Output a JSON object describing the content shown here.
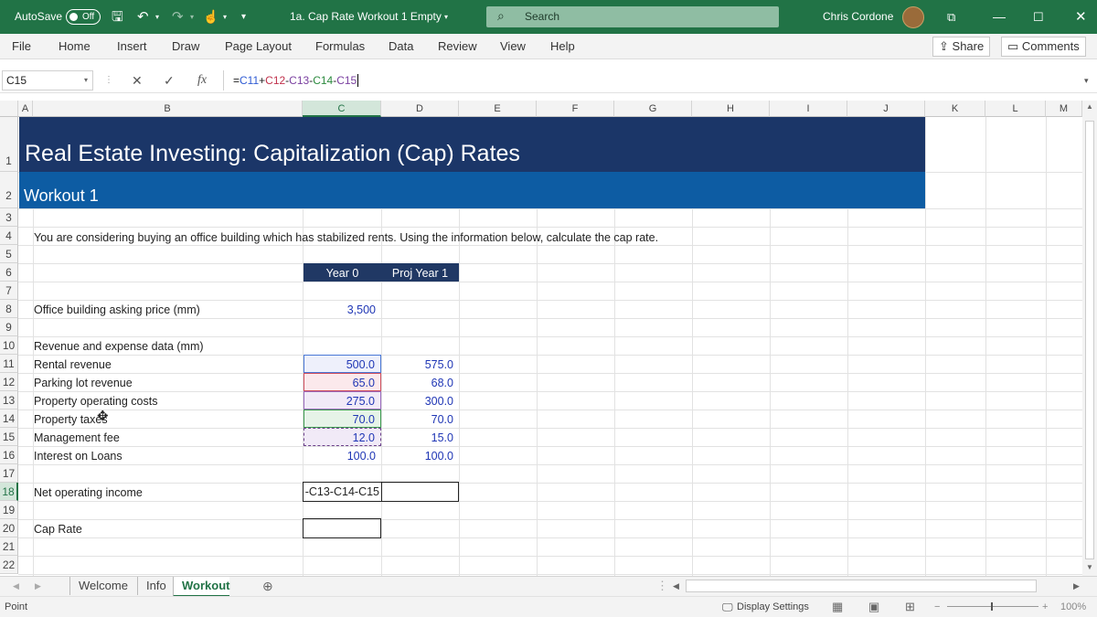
{
  "titlebar": {
    "autosave_label": "AutoSave",
    "autosave_state": "Off",
    "document_title": "1a. Cap Rate Workout 1 Empty",
    "search_placeholder": "Search",
    "user_name": "Chris Cordone"
  },
  "ribbon": {
    "tabs": [
      "File",
      "Home",
      "Insert",
      "Draw",
      "Page Layout",
      "Formulas",
      "Data",
      "Review",
      "View",
      "Help"
    ],
    "share_label": "Share",
    "comments_label": "Comments"
  },
  "formula_bar": {
    "name_box": "C15",
    "fx": "fx",
    "formula_parts": [
      "=",
      "C11",
      "+",
      "C12",
      "-",
      "C13",
      "-",
      "C14",
      "-",
      "C15"
    ]
  },
  "columns": [
    "A",
    "B",
    "C",
    "D",
    "E",
    "F",
    "G",
    "H",
    "I",
    "J",
    "K",
    "L",
    "M"
  ],
  "rows": [
    "1",
    "2",
    "3",
    "4",
    "5",
    "6",
    "7",
    "8",
    "9",
    "10",
    "11",
    "12",
    "13",
    "14",
    "15",
    "16",
    "17",
    "18",
    "19",
    "20",
    "21",
    "22"
  ],
  "sheet": {
    "title": "Real Estate Investing: Capitalization (Cap) Rates",
    "subtitle": "Workout 1",
    "instructions": "You are considering buying an office building which has stabilized rents.  Using the information below, calculate the cap rate.",
    "header_year0": "Year 0",
    "header_proj": "Proj Year 1",
    "asking_price_label": "Office building asking price (mm)",
    "asking_price_value": "3,500",
    "section_label": "Revenue and expense data (mm)",
    "items": [
      {
        "label": "Rental revenue",
        "y0": "500.0",
        "y1": "575.0"
      },
      {
        "label": "Parking lot revenue",
        "y0": "65.0",
        "y1": "68.0"
      },
      {
        "label": "Property operating costs",
        "y0": "275.0",
        "y1": "300.0"
      },
      {
        "label": "Property taxes",
        "y0": "70.0",
        "y1": "70.0"
      },
      {
        "label": "Management fee",
        "y0": "12.0",
        "y1": "15.0"
      },
      {
        "label": "Interest on Loans",
        "y0": "100.0",
        "y1": "100.0"
      }
    ],
    "noi_label": "Net operating income",
    "noi_edit_text": "-C13-C14-C15",
    "cap_rate_label": "Cap Rate"
  },
  "sheet_tabs": [
    "Welcome",
    "Info",
    "Workout"
  ],
  "active_sheet": "Workout",
  "status": {
    "mode": "Point",
    "display_settings": "Display Settings",
    "zoom": "100%"
  },
  "colors": {
    "excel_green": "#217346",
    "title_band": "#1b3668",
    "subtitle_band": "#0d5ca3",
    "header_fill": "#203864",
    "input_blue": "#1f36b5"
  }
}
